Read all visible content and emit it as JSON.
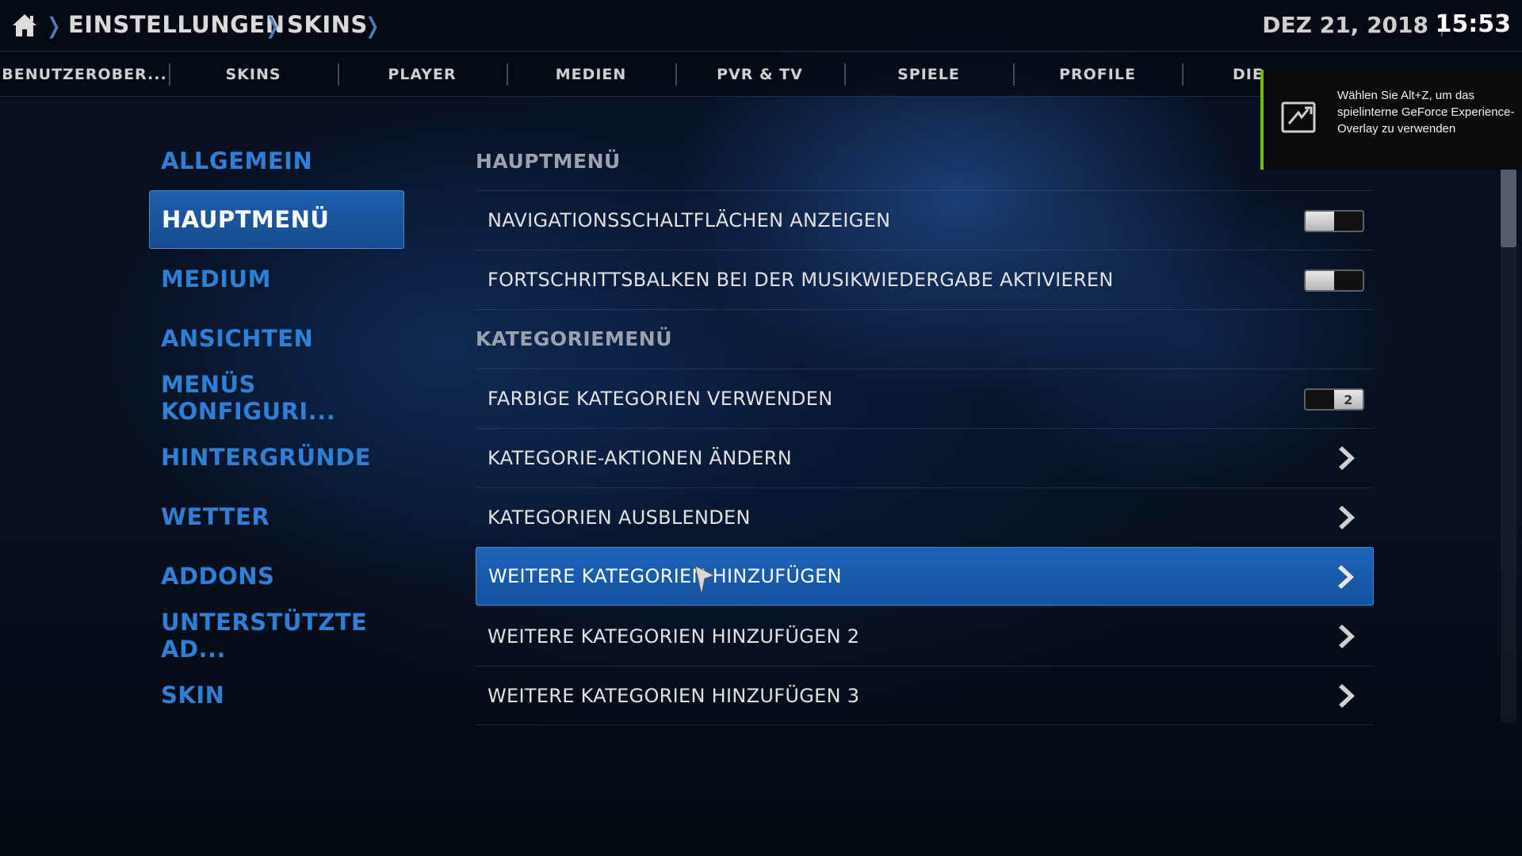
{
  "header": {
    "breadcrumb": [
      "EINSTELLUNGEN",
      "SKINS"
    ],
    "date": "DEZ 21, 2018",
    "time": "15:53"
  },
  "tabs": [
    {
      "label": "BENUTZEROBER..."
    },
    {
      "label": "SKINS"
    },
    {
      "label": "PLAYER"
    },
    {
      "label": "MEDIEN"
    },
    {
      "label": "PVR & TV"
    },
    {
      "label": "SPIELE"
    },
    {
      "label": "PROFILE"
    },
    {
      "label": "DIE"
    }
  ],
  "sidebar": {
    "selected_index": 1,
    "items": [
      {
        "label": "ALLGEMEIN"
      },
      {
        "label": "HAUPTMENÜ"
      },
      {
        "label": "MEDIUM"
      },
      {
        "label": "ANSICHTEN"
      },
      {
        "label": "MENÜS KONFIGURI..."
      },
      {
        "label": "HINTERGRÜNDE"
      },
      {
        "label": "WETTER"
      },
      {
        "label": "ADDONS"
      },
      {
        "label": "UNTERSTÜTZTE AD..."
      },
      {
        "label": "SKIN"
      }
    ]
  },
  "settings": {
    "section_main": "HAUPTMENÜ",
    "section_category": "KATEGORIEMENÜ",
    "items": [
      {
        "label": "NAVIGATIONSSCHALTFLÄCHEN ANZEIGEN",
        "type": "toggle",
        "on": false
      },
      {
        "label": "FORTSCHRITTSBALKEN BEI DER MUSIKWIEDERGABE AKTIVIEREN",
        "type": "toggle",
        "on": false
      },
      {
        "label": "FARBIGE KATEGORIEN VERWENDEN",
        "type": "toggle",
        "on": true,
        "toggle_text": "2"
      },
      {
        "label": "KATEGORIE-AKTIONEN ÄNDERN",
        "type": "arrow"
      },
      {
        "label": "KATEGORIEN AUSBLENDEN",
        "type": "arrow"
      },
      {
        "label": "WEITERE KATEGORIEN HINZUFÜGEN",
        "type": "arrow",
        "selected": true
      },
      {
        "label": "WEITERE KATEGORIEN HINZUFÜGEN 2",
        "type": "arrow"
      },
      {
        "label": "WEITERE KATEGORIEN HINZUFÜGEN 3",
        "type": "arrow"
      }
    ]
  },
  "notification": {
    "text": "Wählen Sie Alt+Z, um das spielinterne GeForce Experience-Overlay zu verwenden",
    "accent_color": "#76b900",
    "icon": "geforce-share-icon"
  },
  "icons": {
    "home": "home-icon",
    "breadcrumb_separator": "chevron-right-icon",
    "row_arrow": "chevron-right-icon"
  },
  "colors": {
    "accent_blue": "#1d63b8",
    "sidebar_text": "#2f7fd6"
  }
}
